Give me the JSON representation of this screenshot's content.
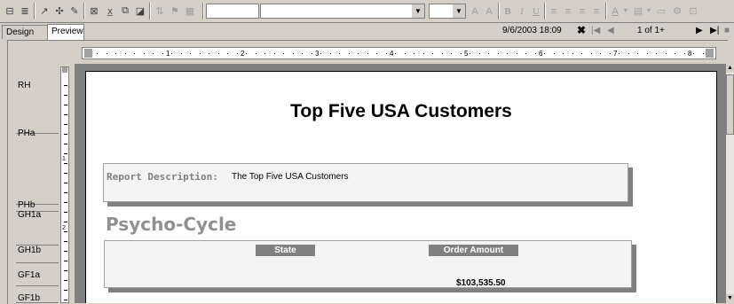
{
  "toolbar": {
    "font_combo_value": "",
    "size_combo_value": "",
    "bold_label": "B",
    "italic_label": "I",
    "underline_label": "U"
  },
  "tabs": [
    {
      "label": "Design"
    },
    {
      "label": "Preview"
    }
  ],
  "status": {
    "datetime": "9/6/2003 18:09",
    "close_glyph": "✖",
    "page_indicator": "1 of 1+"
  },
  "ruler": {
    "numbers": [
      "1",
      "2",
      "3",
      "4",
      "5",
      "6",
      "7",
      "8"
    ]
  },
  "sections": [
    "RH",
    "PHa",
    "PHb",
    "GH1a",
    "GH1b",
    "GF1a",
    "GF1b"
  ],
  "vruler_numbers": [
    "1",
    "2"
  ],
  "report": {
    "title": "Top Five USA Customers",
    "description_label": "Report Description:",
    "description_value": "The Top Five USA Customers",
    "group_name": "Psycho-Cycle",
    "col_state": "State",
    "col_amount": "Order Amount",
    "amount_value": "$103,535.50"
  },
  "colors": {
    "chrome": "#d4d0c8",
    "header_fill": "#808080",
    "group_text": "#909090"
  }
}
